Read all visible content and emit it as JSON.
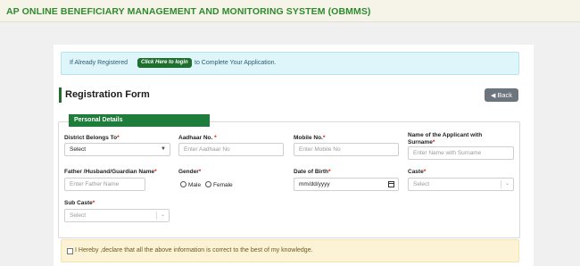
{
  "header": {
    "title": "AP ONLINE BENEFICIARY MANAGEMENT AND MONITORING SYSTEM (OBMMS)"
  },
  "info_bar": {
    "prefix": "If Already Registered",
    "login_button": "Click Here to login",
    "suffix": "to Complete Your Application."
  },
  "form": {
    "title": "Registration Form",
    "back_label": "Back",
    "section": "Personal Details",
    "fields": {
      "district": {
        "label": "District Belongs To",
        "value": "Select"
      },
      "aadhaar": {
        "label": "Aadhaar No.",
        "placeholder": "Enter Aadhaar No"
      },
      "mobile": {
        "label": "Mobile No.",
        "placeholder": "Enter Mobile No"
      },
      "applicant": {
        "label_line1": "Name of the Applicant with",
        "label_line2": "Surname",
        "placeholder": "Enter Name with Surname"
      },
      "father": {
        "label": "Father /Husband/Guardian Name",
        "placeholder": "Enter Father Name"
      },
      "gender": {
        "label": "Gender",
        "options": [
          "Male",
          "Female"
        ]
      },
      "dob": {
        "label": "Date of Birth",
        "placeholder": "mm/dd/yyyy"
      },
      "caste": {
        "label": "Caste",
        "value": "Select"
      },
      "subcaste": {
        "label": "Sub Caste",
        "value": "Select"
      }
    },
    "required_mark": "*",
    "declaration": "I Hereby ,declare that all the above information is correct to the best of my knowledge."
  },
  "colors": {
    "brand_green": "#1e7d3b",
    "title_green": "#2e8a2e",
    "info_bg": "#def5fa",
    "declare_bg": "#fcf3d6"
  },
  "icons": {
    "back": "arrow-left-circle-icon",
    "calendar": "calendar-icon",
    "chevron": "chevron-down-icon"
  }
}
